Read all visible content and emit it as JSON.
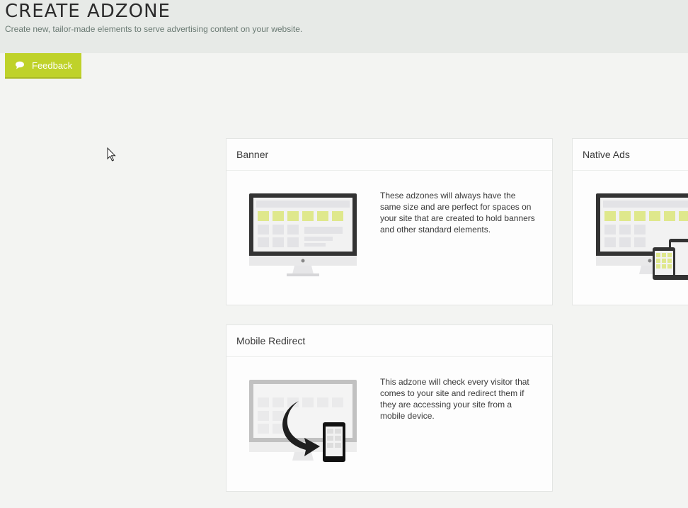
{
  "header": {
    "title": "CREATE ADZONE",
    "subtitle": "Create new, tailor-made elements to serve advertising content on your website."
  },
  "feedback": {
    "label": "Feedback",
    "icon": "speech-bubble-icon"
  },
  "cards": {
    "banner": {
      "title": "Banner",
      "description": "These adzones will always have the same size and are perfect for spaces on your site that are created to hold banners and other standard elements.",
      "icon": "desktop-monitor-icon"
    },
    "native": {
      "title": "Native Ads",
      "icon": "multi-device-icon"
    },
    "mobile": {
      "title": "Mobile Redirect",
      "description": "This adzone will check every visitor that comes to your site and redirect them if they are accessing your site from a mobile device.",
      "icon": "mobile-redirect-icon"
    }
  },
  "colors": {
    "accent": "#bfd22a",
    "page_bg": "#f3f4f2",
    "header_bg": "#e7eae7",
    "card_bg": "#fdfdfd"
  }
}
